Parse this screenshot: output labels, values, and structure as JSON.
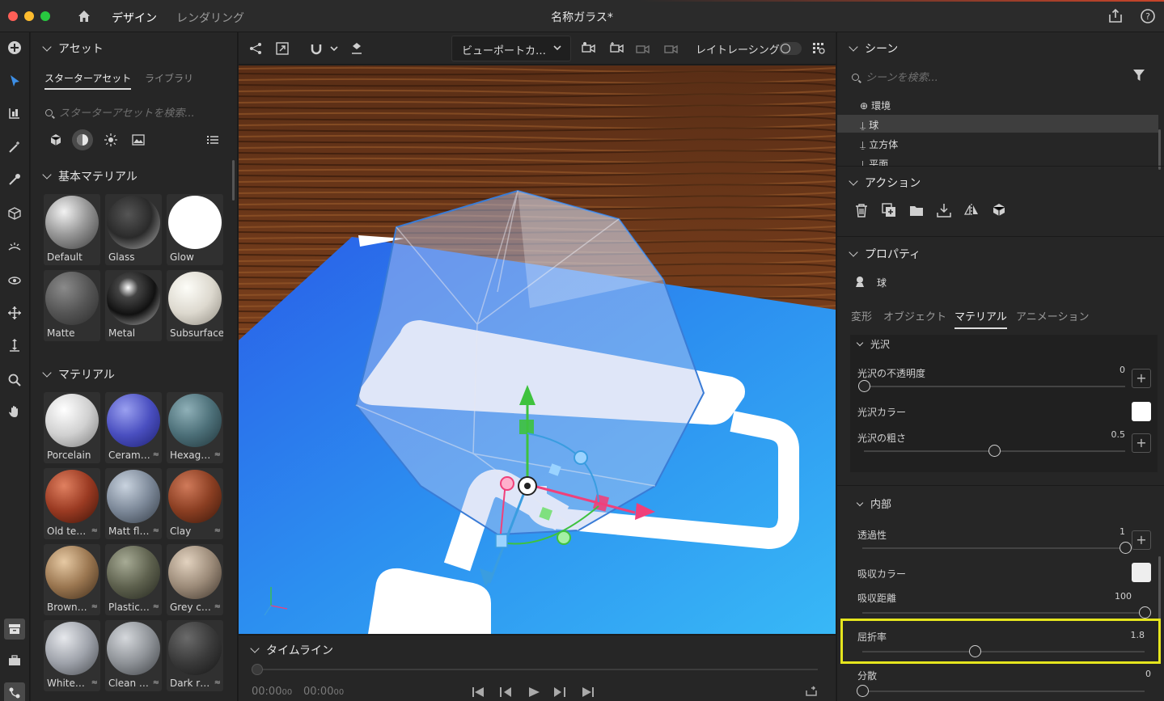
{
  "window": {
    "title": "名称ガラス*",
    "tabs": [
      {
        "label": "デザイン",
        "active": true
      },
      {
        "label": "レンダリング",
        "active": false
      }
    ]
  },
  "assets": {
    "header": "アセット",
    "tabs": [
      "スターターアセット",
      "ライブラリ"
    ],
    "search_placeholder": "スターターアセットを検索...",
    "basic_materials": {
      "header": "基本マテリアル",
      "items": [
        "Default",
        "Glass",
        "Glow",
        "Matte",
        "Metal",
        "Subsurface"
      ]
    },
    "materials": {
      "header": "マテリアル",
      "items": [
        "Porcelain",
        "Ceram…",
        "Hexag…",
        "Old te…",
        "Matt fl…",
        "Clay",
        "Brown…",
        "Plastic…",
        "Grey c…",
        "White…",
        "Clean …",
        "Dark r…"
      ]
    }
  },
  "viewport_toolbar": {
    "camera_select": "ビューポートカ…",
    "raytracing_label": "レイトレーシング",
    "raytracing_on": false
  },
  "timeline": {
    "header": "タイムライン",
    "current_time": "00:00",
    "current_frames": "00",
    "total_time": "00:00",
    "total_frames": "00"
  },
  "scene": {
    "header": "シーン",
    "search_placeholder": "シーンを検索...",
    "items": [
      {
        "label": "環境",
        "icon": "globe-icon",
        "selected": false
      },
      {
        "label": "球",
        "icon": "model-icon",
        "selected": true
      },
      {
        "label": "立方体",
        "icon": "model-icon",
        "selected": false
      },
      {
        "label": "平面",
        "icon": "model-icon",
        "selected": false
      }
    ]
  },
  "actions": {
    "header": "アクション"
  },
  "properties": {
    "header": "プロパティ",
    "object_name": "球",
    "tabs": [
      "変形",
      "オブジェクト",
      "マテリアル",
      "アニメーション"
    ],
    "active_tab": "マテリアル",
    "sheen": {
      "header": "光沢",
      "opacity_label": "光沢の不透明度",
      "opacity_value": "0",
      "opacity_fraction": 0,
      "color_label": "光沢カラー",
      "color": "#ffffff",
      "roughness_label": "光沢の粗さ",
      "roughness_value": "0.5",
      "roughness_fraction": 0.5
    },
    "interior": {
      "header": "内部",
      "transmission_label": "透過性",
      "transmission_value": "1",
      "transmission_fraction": 1,
      "absorption_color_label": "吸収カラー",
      "absorption_color": "#eeeeee",
      "absorption_distance_label": "吸収距離",
      "absorption_distance_value": "100",
      "absorption_distance_fraction": 1,
      "ior_label": "屈折率",
      "ior_value": "1.8",
      "ior_fraction": 0.4,
      "dispersion_label": "分散",
      "dispersion_value": "0",
      "dispersion_fraction": 0
    }
  },
  "colors": {
    "highlight": "#e5e51e",
    "gizmo_x": "#f0407a",
    "gizmo_y": "#3ec23e",
    "gizmo_z": "#3a9de0"
  }
}
